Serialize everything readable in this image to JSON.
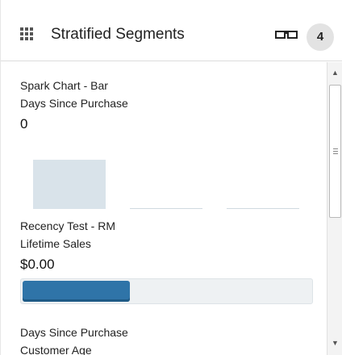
{
  "header": {
    "drag_icon": "grip-dots-icon",
    "title": "Stratified Segments",
    "view_icon": "glasses-icon",
    "count": "4"
  },
  "cards": [
    {
      "name": "Spark Chart - Bar",
      "metric": "Days Since Purchase",
      "value": "0",
      "spark_bars": [
        0.95,
        0,
        0
      ]
    },
    {
      "name": "Recency Test - RM",
      "metric": "Lifetime Sales",
      "value": "$0.00",
      "progress": 0.38
    },
    {
      "name": "Days Since Purchase",
      "metric": "Customer Age"
    }
  ],
  "scrollbar": {
    "up_icon": "scroll-up-arrow-icon",
    "down_icon": "scroll-down-arrow-icon"
  },
  "colors": {
    "spark_bar": "#d9e3ea",
    "progress_fill": "#2f74a8",
    "badge_bg": "#e3e3e3"
  }
}
